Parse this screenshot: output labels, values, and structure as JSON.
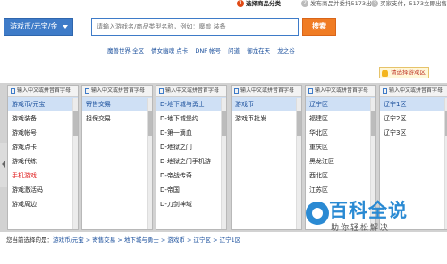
{
  "steps": [
    {
      "num": "1",
      "label": "选择商品分类"
    },
    {
      "num": "2",
      "label": "发布商品并委托5173出售"
    },
    {
      "num": "3",
      "label": "买家支付，5173立即出售"
    }
  ],
  "search": {
    "category_label": "游戏币/元宝/金",
    "placeholder": "请输入游戏名/商品类型名称，例如：魔兽 装备",
    "button_label": "搜索"
  },
  "hot_games": [
    "魔兽世界 全区",
    "倩女幽魂 点卡",
    "DNF 帐号",
    "问道",
    "御龙在天",
    "龙之谷"
  ],
  "notice": "请选择游戏区",
  "column_header": "输入中文或拼音首字母",
  "columns": [
    {
      "items": [
        {
          "label": "游戏币/元宝",
          "selected": true,
          "arrow": true
        },
        {
          "label": "游戏装备"
        },
        {
          "label": "游戏帐号"
        },
        {
          "label": "游戏点卡"
        },
        {
          "label": "游戏代练"
        },
        {
          "label": "手机游戏",
          "red": true
        },
        {
          "label": "游戏激活码"
        },
        {
          "label": "游戏周边"
        }
      ]
    },
    {
      "items": [
        {
          "label": "寄售交易",
          "selected": true,
          "arrow": true
        },
        {
          "label": "担保交易"
        }
      ]
    },
    {
      "items": [
        {
          "label": "D-地下城与勇士",
          "selected": true,
          "arrow": true
        },
        {
          "label": "D-地下城堡约"
        },
        {
          "label": "D-第一滴血"
        },
        {
          "label": "D-地狱之门"
        },
        {
          "label": "D-地狱之门手机游"
        },
        {
          "label": "D-帝战传奇"
        },
        {
          "label": "D-帝国"
        },
        {
          "label": "D-刀剑神域"
        }
      ]
    },
    {
      "items": [
        {
          "label": "游戏币",
          "selected": true,
          "arrow": true
        },
        {
          "label": "游戏币批发"
        }
      ]
    },
    {
      "items": [
        {
          "label": "辽宁区",
          "selected": true,
          "arrow": true
        },
        {
          "label": "福建区"
        },
        {
          "label": "华北区"
        },
        {
          "label": "重庆区"
        },
        {
          "label": "黑龙江区"
        },
        {
          "label": "西北区"
        },
        {
          "label": "江苏区"
        }
      ]
    },
    {
      "items": [
        {
          "label": "辽宁1区",
          "selected": true
        },
        {
          "label": "辽宁2区"
        },
        {
          "label": "辽宁3区"
        }
      ]
    }
  ],
  "status": {
    "prefix": "您当前选择的是：",
    "path": "游戏币/元宝 > 寄售交易 > 地下城与勇士 > 游戏币 > 辽宁区 > 辽宁1区"
  },
  "watermark": {
    "title": "百科全说",
    "subtitle": "助你轻松解决"
  },
  "colors": {
    "accent": "#3e7bc8",
    "button": "#f07c24",
    "selected": "#cfe0f5",
    "red": "#e02020"
  }
}
